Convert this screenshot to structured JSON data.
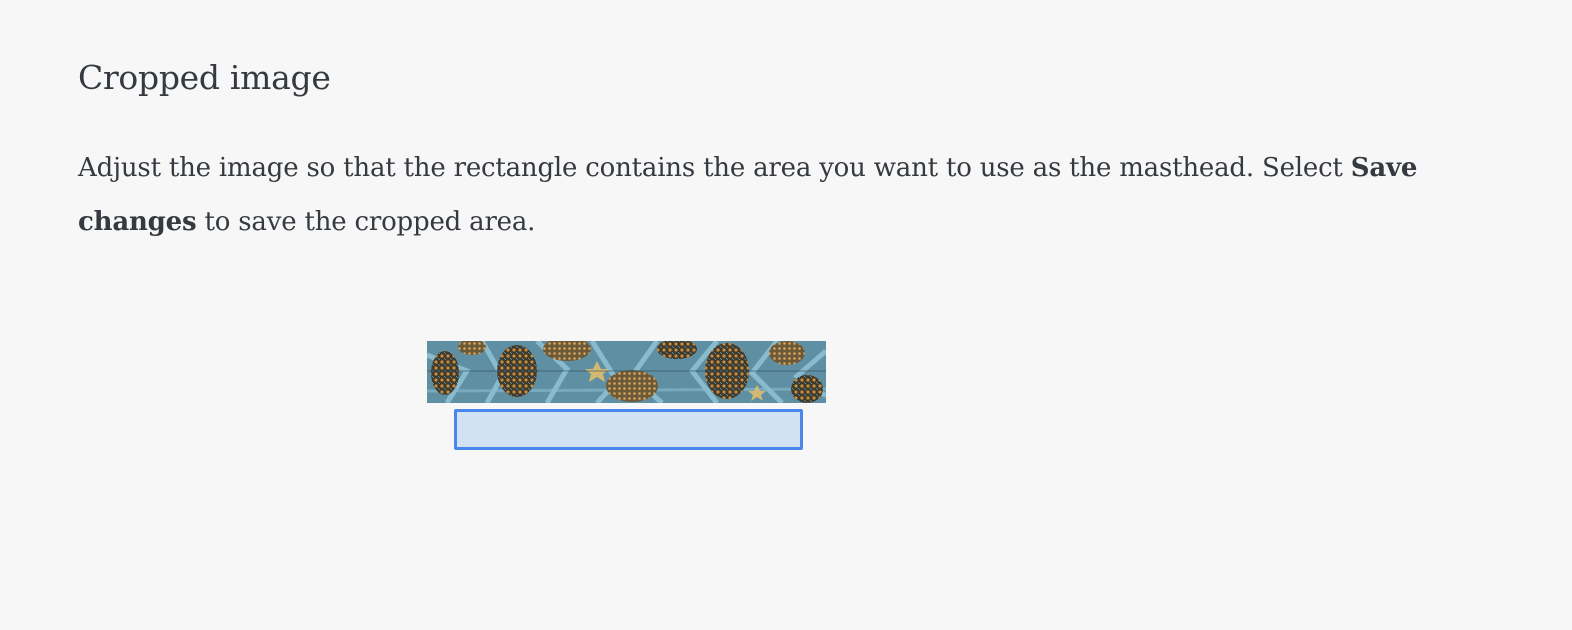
{
  "page": {
    "title": "Cropped image",
    "instruction_before": "Adjust the image so that the rectangle contains the area you want to use as the masthead. Select ",
    "instruction_strong": "Save changes",
    "instruction_after": " to save the cropped area."
  },
  "crop": {
    "image_icon": "mosaic-tile-image",
    "rect_icon": "crop-rectangle"
  },
  "colors": {
    "background": "#f7f7f7",
    "text": "#353a40",
    "crop_border": "#4a87ec",
    "crop_fill": "#d2e2f5"
  }
}
